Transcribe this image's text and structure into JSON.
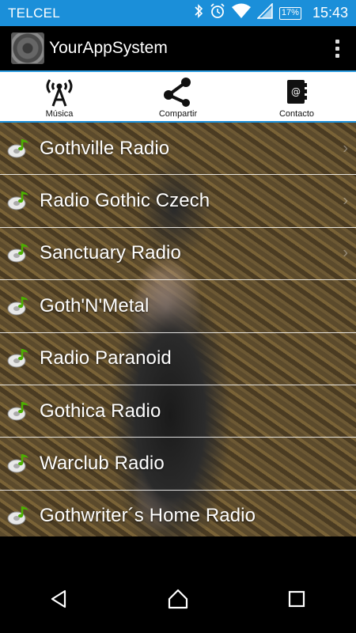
{
  "status_bar": {
    "carrier": "TELCEL",
    "battery": "17%",
    "time": "15:43",
    "icons": [
      "bluetooth-icon",
      "alarm-icon",
      "wifi-icon",
      "signal-icon",
      "battery-icon"
    ]
  },
  "app_bar": {
    "title": "YourAppSystem",
    "logo_icon": "speaker-logo-icon",
    "menu_icon": "overflow-menu-icon"
  },
  "tabs": [
    {
      "label": "Música",
      "icon": "radio-tower-icon"
    },
    {
      "label": "Compartir",
      "icon": "share-icon"
    },
    {
      "label": "Contacto",
      "icon": "contact-book-icon"
    }
  ],
  "stations": [
    {
      "name": "Gothville Radio"
    },
    {
      "name": "Radio Gothic Czech"
    },
    {
      "name": "Sanctuary Radio"
    },
    {
      "name": "Goth'N'Metal"
    },
    {
      "name": "Radio Paranoid"
    },
    {
      "name": "Gothica Radio"
    },
    {
      "name": "Warclub Radio"
    },
    {
      "name": "Gothwriter´s Home Radio"
    }
  ],
  "colors": {
    "accent": "#1b8fd9",
    "status_bar": "#1b8fd9",
    "app_bar": "#000000",
    "music_note": "#4cb000"
  },
  "nav": [
    "back-icon",
    "home-icon",
    "recents-icon"
  ]
}
